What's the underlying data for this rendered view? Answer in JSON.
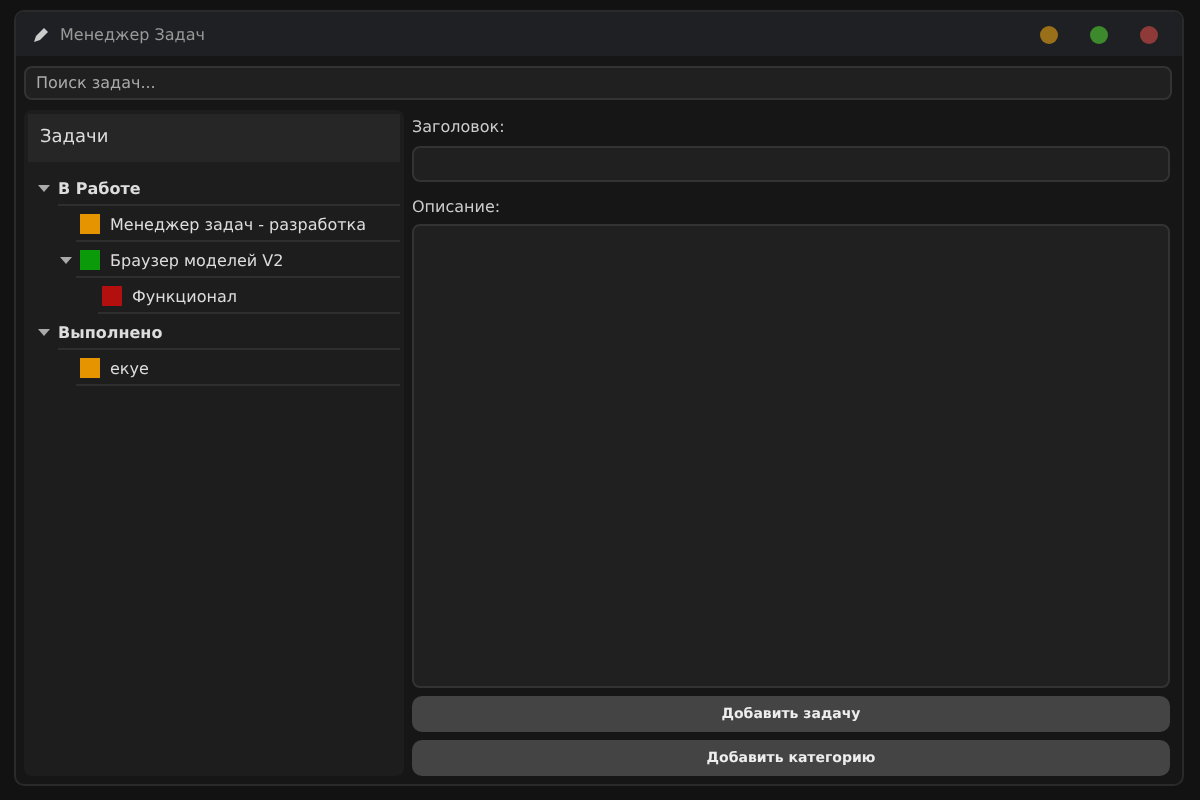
{
  "window": {
    "title": "Менеджер Задач"
  },
  "search": {
    "placeholder": "Поиск задач..."
  },
  "tree": {
    "header": "Задачи",
    "items": [
      {
        "label": "В Работе",
        "kind": "category",
        "expanded": true,
        "children": [
          {
            "label": "Менеджер задач - разработка",
            "kind": "task",
            "color": "#e69500"
          },
          {
            "label": "Браузер моделей V2",
            "kind": "task",
            "color": "#0a9a0a",
            "expanded": true,
            "children": [
              {
                "label": "Функционал",
                "kind": "task",
                "color": "#b30f0f"
              }
            ]
          }
        ]
      },
      {
        "label": "Выполнено",
        "kind": "category",
        "expanded": true,
        "children": [
          {
            "label": "екуе",
            "kind": "task",
            "color": "#e69500"
          }
        ]
      }
    ]
  },
  "form": {
    "title_label": "Заголовок:",
    "description_label": "Описание:"
  },
  "buttons": [
    "Добавить задачу",
    "Добавить категорию"
  ]
}
